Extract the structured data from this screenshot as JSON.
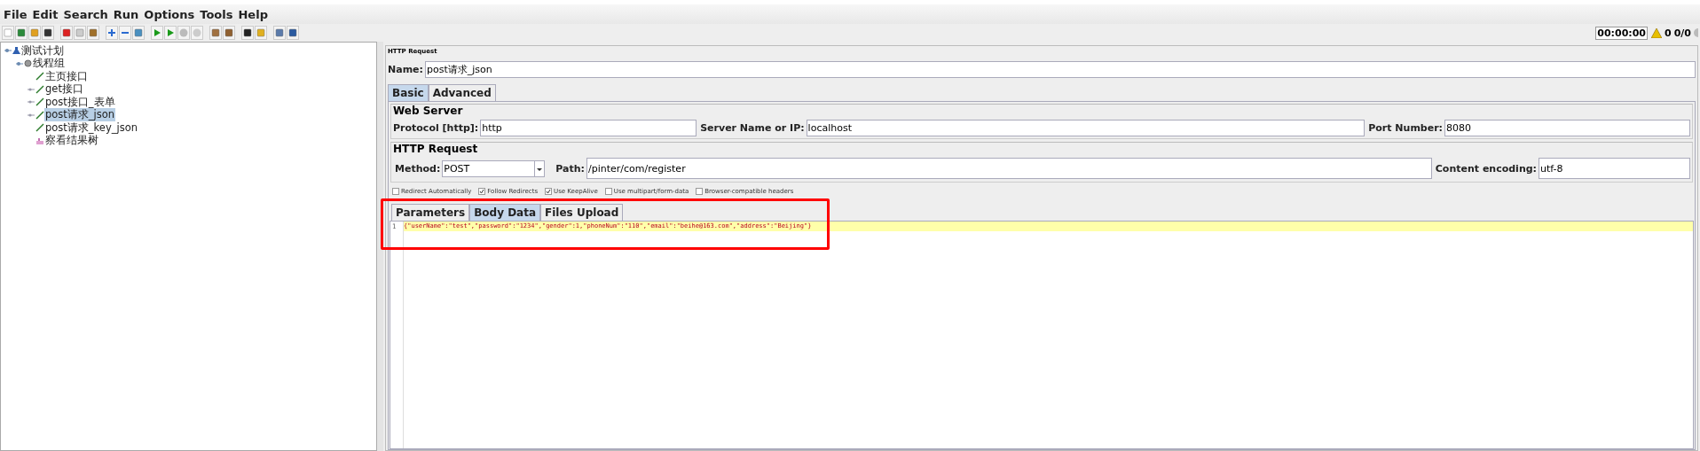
{
  "menu": [
    "File",
    "Edit",
    "Search",
    "Run",
    "Options",
    "Tools",
    "Help"
  ],
  "status": {
    "timer": "00:00:00",
    "warnings": "0",
    "threads": "0/0"
  },
  "tree": [
    {
      "label": "测试计划",
      "kind": "plan",
      "expanded": true,
      "selected": false,
      "children": [
        {
          "label": "线程组",
          "kind": "group",
          "expanded": true,
          "selected": false,
          "children": [
            {
              "label": "主页接口",
              "kind": "sampler",
              "selected": false
            },
            {
              "label": "get接口",
              "kind": "sampler",
              "expanded": false,
              "selected": false
            },
            {
              "label": "post接口_表单",
              "kind": "sampler",
              "expanded": false,
              "selected": false
            },
            {
              "label": "post请求_json",
              "kind": "sampler",
              "expanded": false,
              "selected": true
            },
            {
              "label": "post请求_key_json",
              "kind": "sampler",
              "selected": false
            },
            {
              "label": "察看结果树",
              "kind": "listener",
              "selected": false
            }
          ]
        }
      ]
    }
  ],
  "panel": {
    "title": "HTTP Request",
    "name_label": "Name:",
    "name_value": "post请求_json",
    "tabs": [
      {
        "label": "Basic",
        "selected": true
      },
      {
        "label": "Advanced",
        "selected": false
      }
    ],
    "web_server": {
      "title": "Web Server",
      "protocol_label": "Protocol [http]:",
      "protocol": "http",
      "server_label": "Server Name or IP:",
      "server": "localhost",
      "port_label": "Port Number:",
      "port": "8080"
    },
    "http_request": {
      "title": "HTTP Request",
      "method_label": "Method:",
      "method": "POST",
      "path_label": "Path:",
      "path": "/pinter/com/register",
      "encoding_label": "Content encoding:",
      "encoding": "utf-8"
    },
    "options": [
      {
        "label": "Redirect Automatically",
        "checked": false
      },
      {
        "label": "Follow Redirects",
        "checked": true
      },
      {
        "label": "Use KeepAlive",
        "checked": true
      },
      {
        "label": "Use multipart/form-data",
        "checked": false
      },
      {
        "label": "Browser-compatible headers",
        "checked": false
      }
    ],
    "body_tabs": [
      {
        "label": "Parameters",
        "selected": false
      },
      {
        "label": "Body Data",
        "selected": true
      },
      {
        "label": "Files Upload",
        "selected": false
      }
    ],
    "body_lines": [
      {
        "number": "1",
        "text": "{\"userName\":\"test\",\"password\":\"1234\",\"gender\":1,\"phoneNum\":\"110\",\"email\":\"beihe@163.com\",\"address\":\"Beijing\"}",
        "current": true
      }
    ]
  }
}
